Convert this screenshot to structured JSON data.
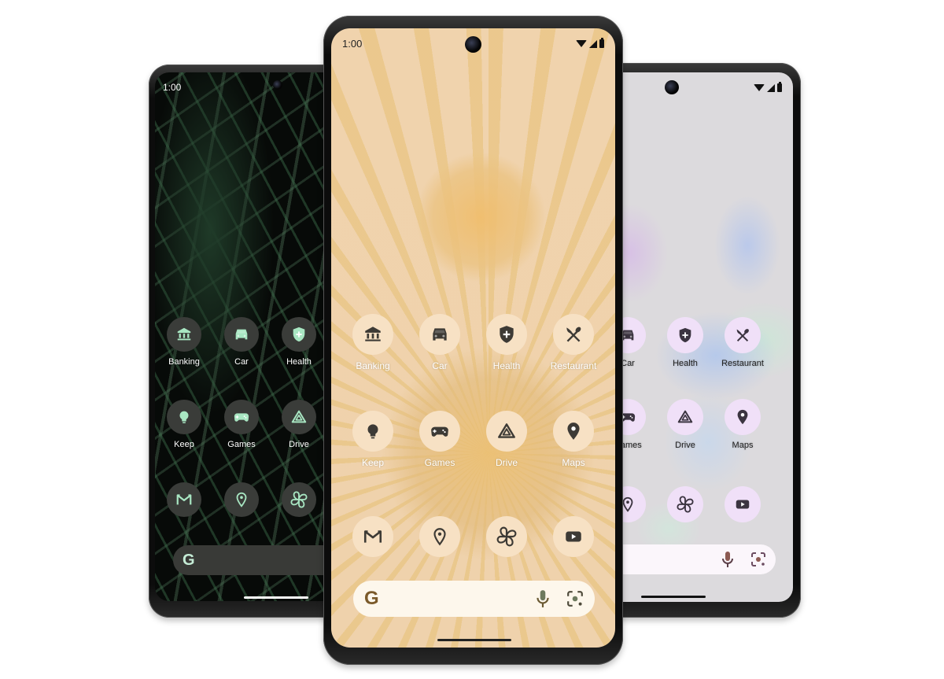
{
  "phones": {
    "left": {
      "theme": "dark-green",
      "status_time": "1:00",
      "accent": "#a8e6c2",
      "bubble_color": "#3a3c39",
      "label_color": "#ffffff",
      "apps": [
        {
          "label": "Banking",
          "icon": "bank-icon"
        },
        {
          "label": "Car",
          "icon": "car-icon"
        },
        {
          "label": "Health",
          "icon": "health-shield-icon"
        },
        {
          "label": "Keep",
          "icon": "lightbulb-icon"
        },
        {
          "label": "Games",
          "icon": "gamepad-icon"
        },
        {
          "label": "Drive",
          "icon": "drive-icon"
        }
      ],
      "dock": [
        {
          "icon": "gmail-icon"
        },
        {
          "icon": "maps-pin-icon"
        },
        {
          "icon": "photos-pinwheel-icon"
        }
      ],
      "search": {
        "logo": "G"
      }
    },
    "center": {
      "theme": "peach",
      "status_time": "1:00",
      "accent": "#3d3a35",
      "bubble_color": "#f7e1c4",
      "label_color": "#ffffff",
      "apps": [
        {
          "label": "Banking",
          "icon": "bank-icon"
        },
        {
          "label": "Car",
          "icon": "car-icon"
        },
        {
          "label": "Health",
          "icon": "health-shield-icon"
        },
        {
          "label": "Restaurant",
          "icon": "restaurant-icon"
        },
        {
          "label": "Keep",
          "icon": "lightbulb-icon"
        },
        {
          "label": "Games",
          "icon": "gamepad-icon"
        },
        {
          "label": "Drive",
          "icon": "drive-icon"
        },
        {
          "label": "Maps",
          "icon": "maps-pin-icon"
        }
      ],
      "dock": [
        {
          "icon": "gmail-icon"
        },
        {
          "icon": "maps-pin-icon"
        },
        {
          "icon": "photos-pinwheel-icon"
        },
        {
          "icon": "youtube-icon"
        }
      ],
      "search": {
        "logo": "G",
        "mic": "mic-icon",
        "lens": "lens-icon"
      }
    },
    "right": {
      "theme": "lilac",
      "accent": "#3b3440",
      "bubble_color": "#f0e0f8",
      "label_color": "#222222",
      "apps": [
        {
          "label": "Car",
          "icon": "car-icon"
        },
        {
          "label": "Health",
          "icon": "health-shield-icon"
        },
        {
          "label": "Restaurant",
          "icon": "restaurant-icon"
        },
        {
          "label": "Games",
          "icon": "gamepad-icon"
        },
        {
          "label": "Drive",
          "icon": "drive-icon"
        },
        {
          "label": "Maps",
          "icon": "maps-pin-icon"
        }
      ],
      "dock": [
        {
          "icon": "maps-pin-icon"
        },
        {
          "icon": "photos-pinwheel-icon"
        },
        {
          "icon": "youtube-icon"
        }
      ],
      "search": {
        "mic": "mic-icon",
        "lens": "lens-icon"
      }
    }
  }
}
